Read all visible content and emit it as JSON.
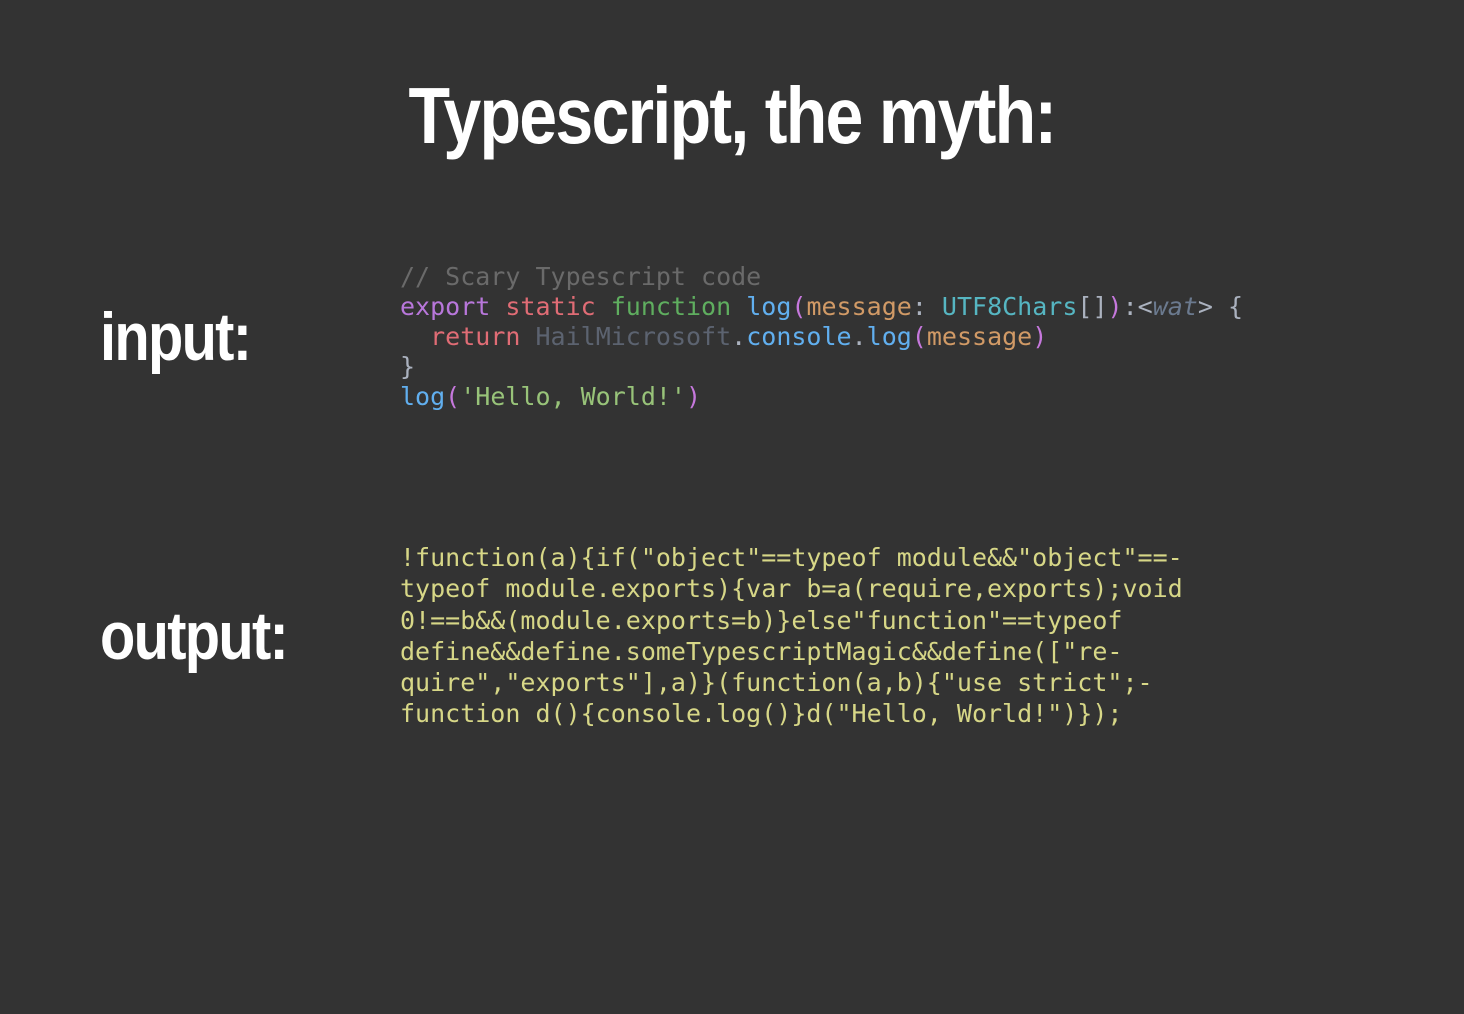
{
  "title": "Typescript, the myth:",
  "labels": {
    "input": "input:",
    "output": "output:"
  },
  "input_code": {
    "line1_comment": "// Scary Typescript code",
    "line2": {
      "export": "export",
      "static": "static",
      "function": "function",
      "fname": "log",
      "lparen": "(",
      "param": "message",
      "colon": ": ",
      "type": "UTF8Chars",
      "brackets": "[]",
      "rparen": ")",
      "colon2": ":",
      "lt": "<",
      "wat": "wat",
      "gt": ">",
      "brace": " {"
    },
    "line3": {
      "indent": "  ",
      "return": "return",
      "hail": "HailMicrosoft",
      "dot1": ".",
      "console": "console",
      "dot2": ".",
      "log": "log",
      "lparen": "(",
      "msg": "message",
      "rparen": ")"
    },
    "line4": "}",
    "line5": {
      "fname": "log",
      "lparen": "(",
      "str": "'Hello, World!'",
      "rparen": ")"
    }
  },
  "output_code": {
    "l1": "!function(a){if(\"object\"==typeof module&&\"object\"==-",
    "l2": "typeof module.exports){var b=a(require,exports);void",
    "l3": "0!==b&&(module.exports=b)}else\"function\"==typeof",
    "l4": "define&&define.someTypescriptMagic&&define([\"re-",
    "l5": "quire\",\"exports\"],a)}(function(a,b){\"use strict\";-",
    "l6": "function d(){console.log()}d(\"Hello, World!\")});"
  }
}
